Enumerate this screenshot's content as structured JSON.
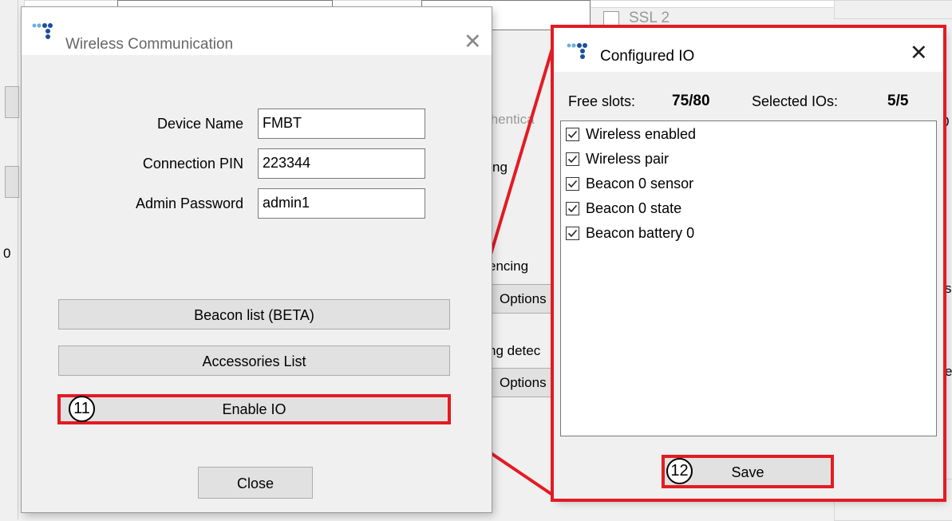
{
  "background": {
    "checkbox_label": "SSL 2",
    "partial_auth": "thentica",
    "partial_ng": "ng",
    "geofencing_label": "encing",
    "options_1": "Options",
    "detection_label": "ng detec",
    "options_2": "Options",
    "left_text": "0",
    "right_frag_1": "0",
    "right_frag_2": "s",
    "right_frag_3": "e"
  },
  "wireless_dialog": {
    "title": "Wireless Communication",
    "fields": [
      {
        "label": "Device Name",
        "value": "FMBT"
      },
      {
        "label": "Connection PIN",
        "value": "223344"
      },
      {
        "label": "Admin Password",
        "value": "admin1"
      }
    ],
    "buttons": {
      "beacon_list": "Beacon list (BETA)",
      "accessories_list": "Accessories List",
      "enable_io": "Enable IO",
      "close": "Close"
    },
    "callout_number": "11"
  },
  "configured_io_dialog": {
    "title": "Configured IO",
    "free_slots_label": "Free slots:",
    "free_slots_value": "75/80",
    "selected_label": "Selected IOs:",
    "selected_value": "5/5",
    "items": [
      {
        "label": "Wireless enabled",
        "checked": true
      },
      {
        "label": "Wireless pair",
        "checked": true
      },
      {
        "label": "Beacon 0 sensor",
        "checked": true
      },
      {
        "label": "Beacon 0 state",
        "checked": true
      },
      {
        "label": "Beacon battery 0",
        "checked": true
      }
    ],
    "save_label": "Save",
    "callout_number": "12"
  },
  "colors": {
    "highlight": "#e31b23",
    "logo_blue": "#1a4f9c",
    "logo_light": "#6aaee0"
  }
}
